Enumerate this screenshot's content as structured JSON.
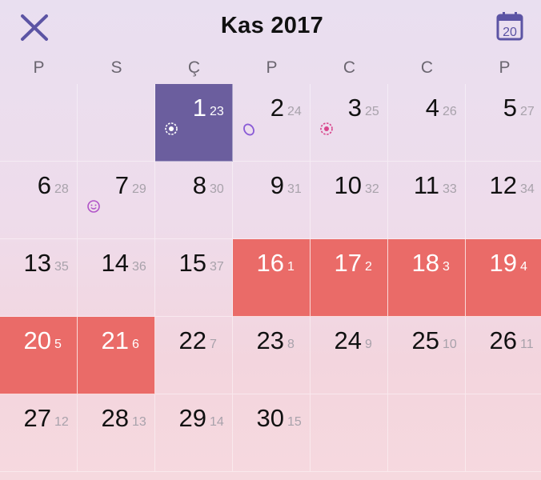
{
  "header": {
    "title": "Kas 2017",
    "close_icon": "close-icon",
    "calendar_icon": "calendar-today-icon",
    "today_badge": "20"
  },
  "weekdays": [
    "P",
    "S",
    "Ç",
    "P",
    "C",
    "C",
    "P"
  ],
  "colors": {
    "accent": "#6b5e9e",
    "period": "#ea6b68",
    "icon_purple": "#5c54a4"
  },
  "weeks": [
    {
      "days": [
        {
          "day": "",
          "cycle": ""
        },
        {
          "day": "",
          "cycle": ""
        },
        {
          "day": "1",
          "cycle": "23",
          "state": "today",
          "icon": "gear-icon"
        },
        {
          "day": "2",
          "cycle": "24",
          "icon": "ovulation-icon"
        },
        {
          "day": "3",
          "cycle": "25",
          "icon": "gear-icon-pink"
        },
        {
          "day": "4",
          "cycle": "26"
        },
        {
          "day": "5",
          "cycle": "27"
        }
      ]
    },
    {
      "days": [
        {
          "day": "6",
          "cycle": "28"
        },
        {
          "day": "7",
          "cycle": "29",
          "icon": "smiley-icon"
        },
        {
          "day": "8",
          "cycle": "30"
        },
        {
          "day": "9",
          "cycle": "31"
        },
        {
          "day": "10",
          "cycle": "32"
        },
        {
          "day": "11",
          "cycle": "33"
        },
        {
          "day": "12",
          "cycle": "34"
        }
      ]
    },
    {
      "days": [
        {
          "day": "13",
          "cycle": "35"
        },
        {
          "day": "14",
          "cycle": "36"
        },
        {
          "day": "15",
          "cycle": "37"
        },
        {
          "day": "16",
          "cycle": "1",
          "state": "period"
        },
        {
          "day": "17",
          "cycle": "2",
          "state": "period"
        },
        {
          "day": "18",
          "cycle": "3",
          "state": "period"
        },
        {
          "day": "19",
          "cycle": "4",
          "state": "period"
        }
      ]
    },
    {
      "days": [
        {
          "day": "20",
          "cycle": "5",
          "state": "period"
        },
        {
          "day": "21",
          "cycle": "6",
          "state": "period"
        },
        {
          "day": "22",
          "cycle": "7"
        },
        {
          "day": "23",
          "cycle": "8"
        },
        {
          "day": "24",
          "cycle": "9"
        },
        {
          "day": "25",
          "cycle": "10"
        },
        {
          "day": "26",
          "cycle": "11"
        }
      ]
    },
    {
      "days": [
        {
          "day": "27",
          "cycle": "12"
        },
        {
          "day": "28",
          "cycle": "13"
        },
        {
          "day": "29",
          "cycle": "14"
        },
        {
          "day": "30",
          "cycle": "15"
        },
        {
          "day": "",
          "cycle": ""
        },
        {
          "day": "",
          "cycle": ""
        },
        {
          "day": "",
          "cycle": ""
        }
      ]
    }
  ]
}
